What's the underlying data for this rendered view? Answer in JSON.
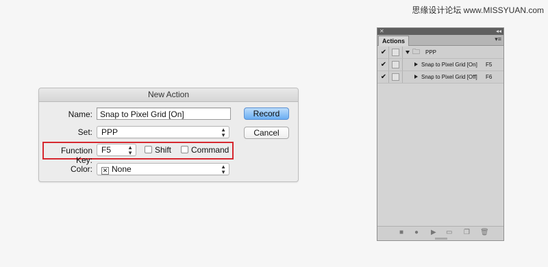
{
  "watermark": "思缘设计论坛 www.MISSYUAN.com",
  "dialog": {
    "title": "New Action",
    "name_label": "Name:",
    "name_value": "Snap to Pixel Grid [On]",
    "set_label": "Set:",
    "set_value": "PPP",
    "function_key_label": "Function Key:",
    "function_key_value": "F5",
    "shift_label": "Shift",
    "command_label": "Command",
    "color_label": "Color:",
    "color_value": "None",
    "record_label": "Record",
    "cancel_label": "Cancel",
    "highlight_color": "#d6282f"
  },
  "actions_panel": {
    "tab_label": "Actions",
    "set_name": "PPP",
    "actions": [
      {
        "name": "Snap to Pixel Grid [On]",
        "key": "F5"
      },
      {
        "name": "Snap to Pixel Grid [Off]",
        "key": "F6"
      }
    ],
    "bottom_icons": [
      "stop-icon",
      "record-icon",
      "play-icon",
      "folder-icon",
      "new-action-icon",
      "trash-icon"
    ]
  }
}
